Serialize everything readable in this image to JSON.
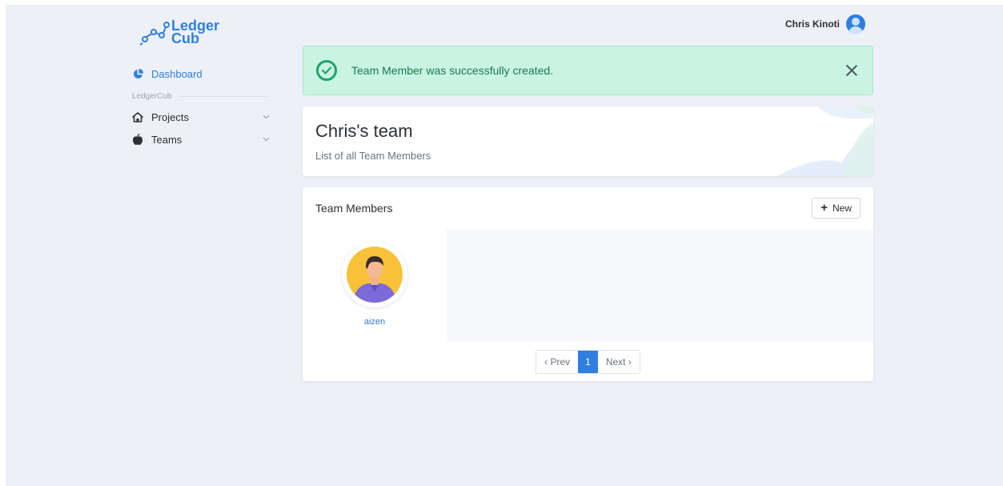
{
  "brand": {
    "line1": "Ledger",
    "line2": "Cub"
  },
  "user": {
    "name": "Chris Kinoti"
  },
  "sidebar": {
    "dashboard": "Dashboard",
    "section": "LedgerCub",
    "items": [
      {
        "label": "Projects"
      },
      {
        "label": "Teams"
      }
    ]
  },
  "alert": {
    "message": "Team Member was successfully created."
  },
  "hero": {
    "title": "Chris's team",
    "subtitle": "List of all Team Members"
  },
  "card": {
    "title": "Team Members",
    "new_label": "New",
    "members": [
      {
        "name": "aizen"
      }
    ]
  },
  "pagination": {
    "prev": "‹ Prev",
    "current": "1",
    "next": "Next ›"
  },
  "colors": {
    "accent": "#2f7fe0",
    "success_bg": "#c9f3e2",
    "success_icon": "#1ea36a",
    "page_bg": "#edf1f7"
  }
}
